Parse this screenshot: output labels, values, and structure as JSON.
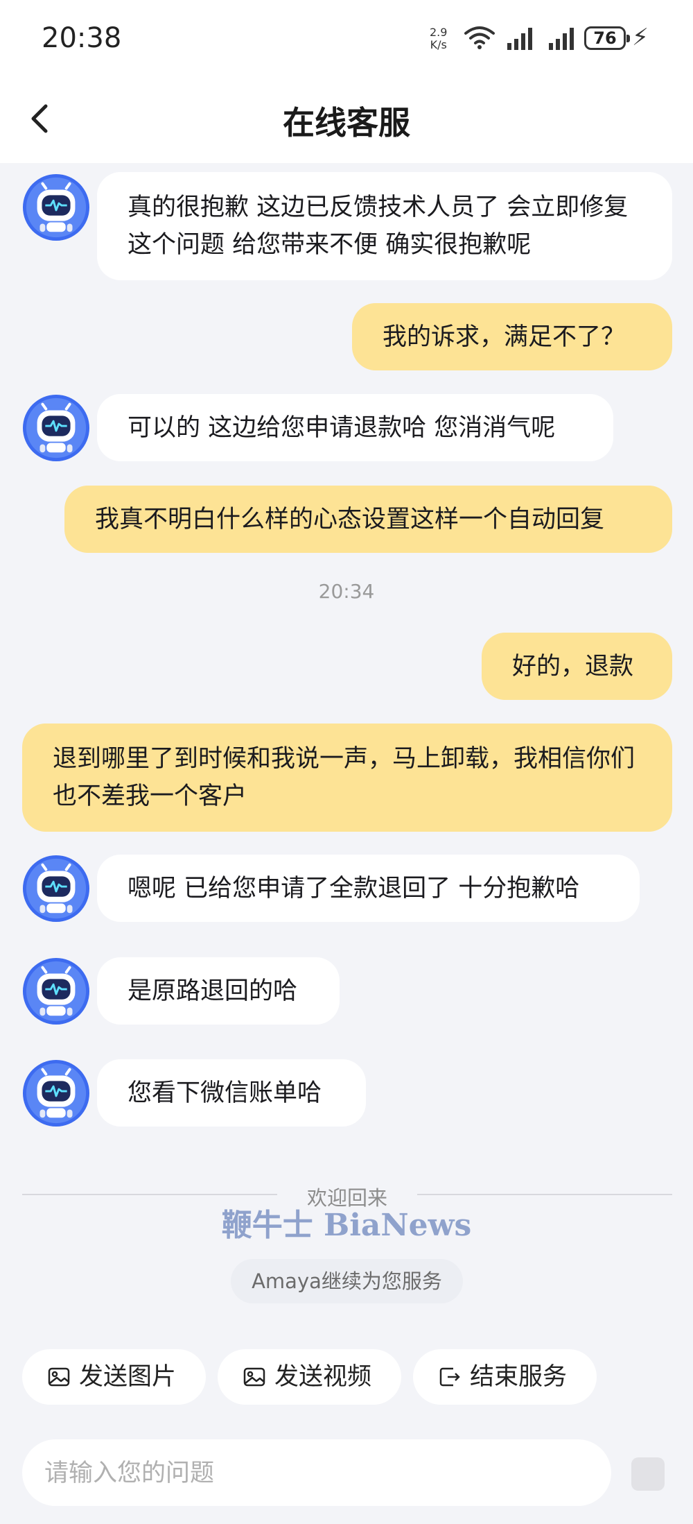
{
  "status": {
    "time": "20:38",
    "net_speed": "2.9",
    "net_unit": "K/s",
    "battery": "76"
  },
  "header": {
    "title": "在线客服"
  },
  "messages": [
    {
      "from": "bot",
      "text": "真的很抱歉 这边已反馈技术人员了 会立即修复这个问题 给您带来不便 确实很抱歉呢"
    },
    {
      "from": "user",
      "text": "我的诉求，满足不了？"
    },
    {
      "from": "bot",
      "text": "可以的 这边给您申请退款哈 您消消气呢"
    },
    {
      "from": "user",
      "text": "我真不明白什么样的心态设置这样一个自动回复"
    },
    {
      "timestamp": "20:34"
    },
    {
      "from": "user",
      "text": "好的，退款"
    },
    {
      "from": "user",
      "text": "退到哪里了到时候和我说一声，马上卸载，我相信你们也不差我一个客户"
    },
    {
      "from": "bot",
      "text": "嗯呢 已给您申请了全款退回了 十分抱歉哈"
    },
    {
      "from": "bot",
      "text": "是原路退回的哈"
    },
    {
      "from": "bot",
      "text": "您看下微信账单哈"
    }
  ],
  "welcome": {
    "divider_text": "欢迎回来",
    "watermark": "鞭牛士 BiaNews",
    "serving_text": "Amaya继续为您服务"
  },
  "actions": [
    {
      "label": "发送图片",
      "icon": "image-icon"
    },
    {
      "label": "发送视频",
      "icon": "video-icon"
    },
    {
      "label": "结束服务",
      "icon": "exit-icon"
    }
  ],
  "input": {
    "placeholder": "请输入您的问题"
  },
  "colors": {
    "user_bubble": "#fde395",
    "bot_bubble": "#ffffff",
    "background": "#f3f4f8",
    "avatar_blue": "#3d6bf0"
  }
}
